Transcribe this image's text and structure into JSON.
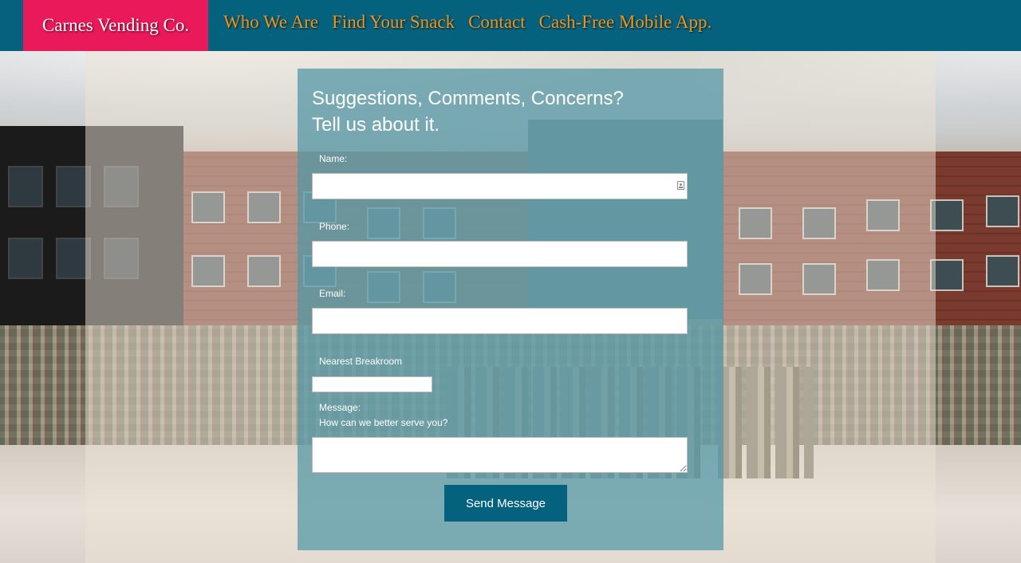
{
  "header": {
    "brand": "Carnes Vending Co.",
    "nav": [
      {
        "label": "Who We Are"
      },
      {
        "label": "Find Your Snack"
      },
      {
        "label": "Contact"
      },
      {
        "label": "Cash-Free Mobile App."
      }
    ],
    "colors": {
      "bar": "#04627f",
      "brand_bg": "#e9195a",
      "link": "#f3921b"
    }
  },
  "form": {
    "heading_line1": "Suggestions, Comments, Concerns?",
    "heading_line2": "Tell us about it.",
    "name_label": "Name:",
    "name_value": "",
    "phone_label": "Phone:",
    "phone_value": "",
    "email_label": "Email:",
    "email_value": "",
    "breakroom_label": "Nearest Breakroom",
    "breakroom_selected": "",
    "message_label": "Message:",
    "message_hint": "How can we better serve you?",
    "message_value": "",
    "submit_label": "Send Message",
    "autofill_icon": "contact-card-icon",
    "panel_color": "#5096a5"
  },
  "background": {
    "photo": "group photo of people in front of a brick office building"
  }
}
